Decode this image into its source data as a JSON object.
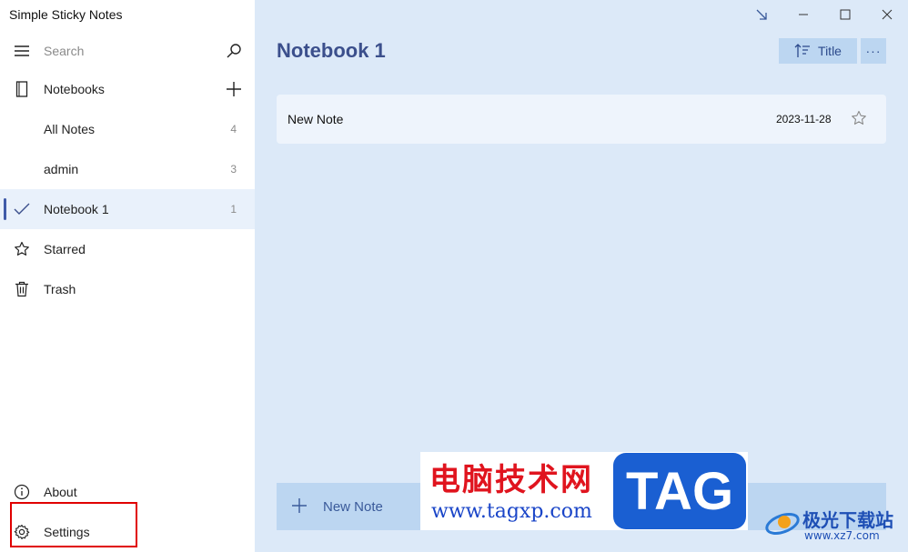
{
  "app": {
    "title": "Simple Sticky Notes"
  },
  "sidebar": {
    "search_placeholder": "Search",
    "notebooks_label": "Notebooks",
    "items": [
      {
        "label": "All Notes",
        "count": "4"
      },
      {
        "label": "admin",
        "count": "3"
      },
      {
        "label": "Notebook 1",
        "count": "1"
      }
    ],
    "starred_label": "Starred",
    "trash_label": "Trash",
    "about_label": "About",
    "settings_label": "Settings"
  },
  "main": {
    "notebook_title": "Notebook 1",
    "sort_label": "Title",
    "more_label": "···",
    "notes": [
      {
        "title": "New Note",
        "date": "2023-11-28"
      }
    ],
    "new_note_label": "New Note"
  },
  "watermark": {
    "cn_text": "电脑技术网",
    "url": "www.tagxp.com",
    "tag": "TAG",
    "right_cn": "极光下载站",
    "right_url": "www.xz7.com"
  },
  "colors": {
    "accent": "#3b4f8c",
    "main_bg": "#dce9f8",
    "button_bg": "#bcd6f1",
    "highlight_border": "#e00000"
  }
}
